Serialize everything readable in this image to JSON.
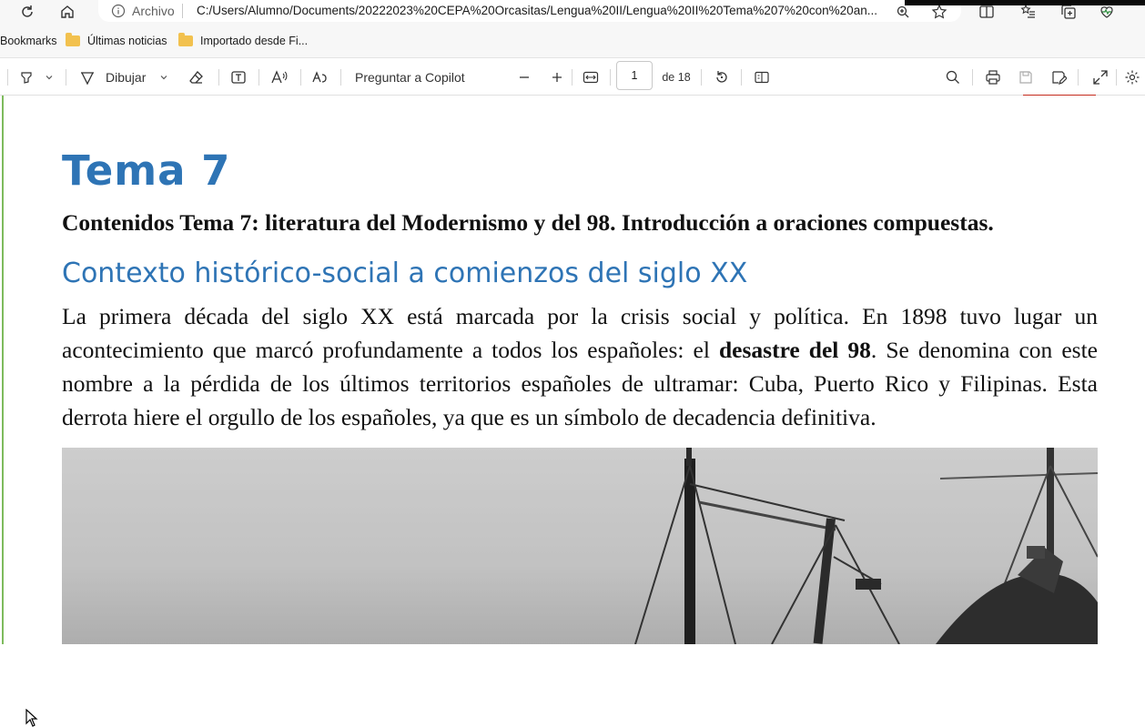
{
  "address_bar": {
    "site_info_label": "Archivo",
    "url": "C:/Users/Alumno/Documents/20222023%20CEPA%20Orcasitas/Lengua%20II/Lengua%20II%20Tema%207%20con%20an..."
  },
  "bookmarks": {
    "items": [
      {
        "label": "Bookmarks",
        "icon": "none"
      },
      {
        "label": "Últimas noticias",
        "icon": "folder-icon"
      },
      {
        "label": "Importado desde Fi...",
        "icon": "folder-icon"
      }
    ]
  },
  "pdf_toolbar": {
    "draw_label": "Dibujar",
    "copilot_label": "Preguntar a Copilot",
    "page_current": "1",
    "page_total_label": "de 18"
  },
  "document": {
    "title": "Tema 7",
    "subtitle": "Contenidos Tema 7: literatura del Modernismo y del 98. Introducción a oraciones compuestas.",
    "heading": "Contexto histórico-social a comienzos del siglo XX",
    "para_part1": "La primera década del siglo XX está marcada por la crisis social y política. En 1898 tuvo lugar un acontecimiento que marcó profundamente a todos los españoles: el ",
    "para_bold": "desastre del 98",
    "para_part2": ". Se denomina con este nombre a la pérdida de los últimos territorios españoles de ultramar: Cuba, Puerto Rico y Filipinas. Esta derrota hiere el orgullo de los españoles, ya que es un símbolo de decadencia definitiva."
  },
  "colors": {
    "heading_blue": "#2e74b5",
    "accent_red": "#c42b1c",
    "margin_green": "#7dbb5c"
  }
}
